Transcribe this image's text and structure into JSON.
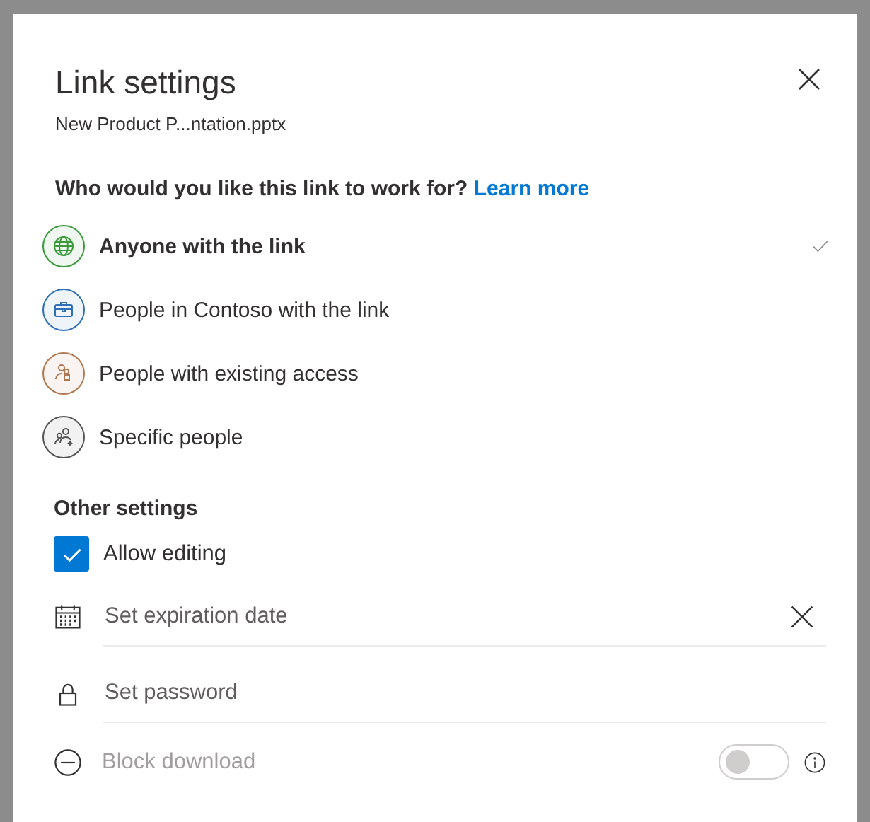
{
  "title": "Link settings",
  "file_name": "New Product P...ntation.pptx",
  "question": "Who would you like this link to work for?",
  "learn_more": "Learn more",
  "options": [
    {
      "label": "Anyone with the link",
      "kind": "globe",
      "color": "#3a9a3a",
      "selected": true
    },
    {
      "label": "People in Contoso with the link",
      "kind": "organization",
      "color": "#2f6fb5",
      "selected": false
    },
    {
      "label": "People with existing access",
      "kind": "existing",
      "color": "#b07850",
      "selected": false
    },
    {
      "label": "Specific people",
      "kind": "specific",
      "color": "#555555",
      "selected": false
    }
  ],
  "other_settings": {
    "heading": "Other settings",
    "allow_editing": {
      "label": "Allow editing",
      "checked": true
    },
    "fields": [
      {
        "kind": "date",
        "placeholder": "Set expiration date",
        "clearable": true
      },
      {
        "kind": "password",
        "placeholder": "Set password",
        "clearable": false
      }
    ],
    "block_download": {
      "label": "Block download",
      "disabled": true,
      "on": false
    }
  }
}
